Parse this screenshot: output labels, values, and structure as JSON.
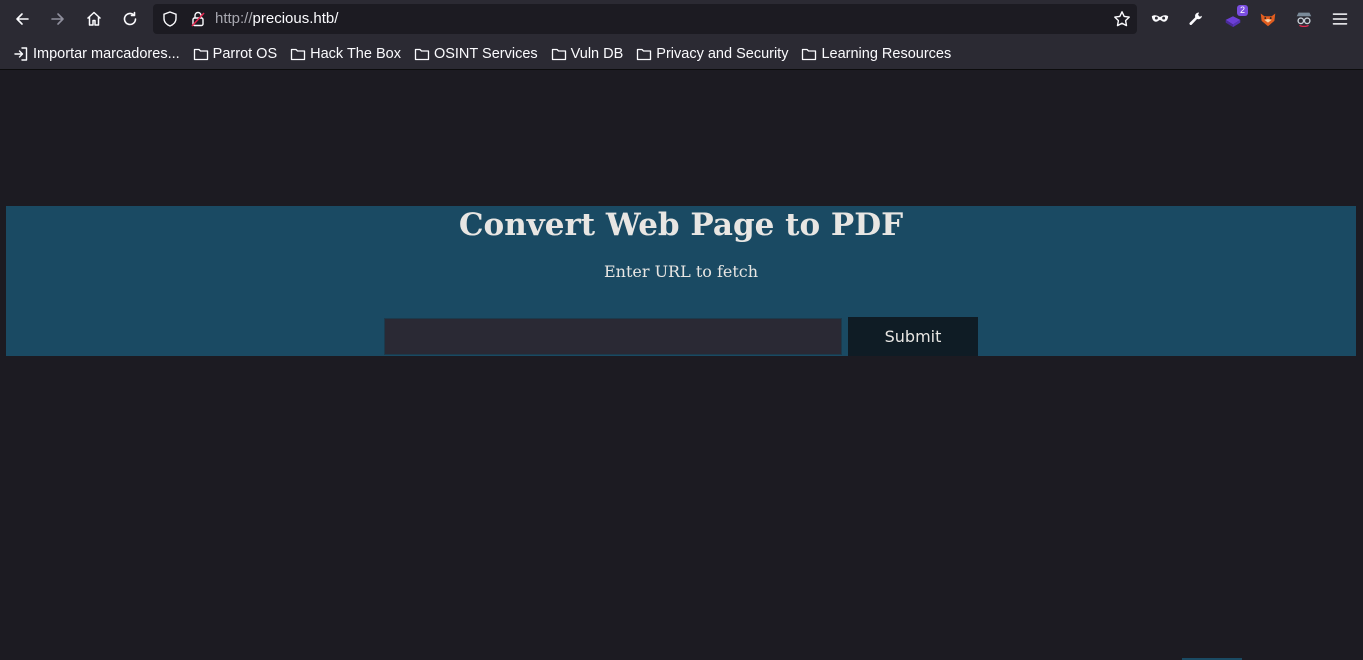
{
  "browser": {
    "url_scheme": "http://",
    "url_host": "precious.htb/",
    "extensions": [
      {
        "icon": "mask-icon"
      },
      {
        "icon": "wrench-icon"
      },
      {
        "icon": "extension-badge-icon",
        "badge": "2"
      },
      {
        "icon": "fox-extension-icon"
      },
      {
        "icon": "spy-extension-icon"
      }
    ]
  },
  "bookmarks": [
    {
      "label": "Importar marcadores...",
      "icon": "import-icon"
    },
    {
      "label": "Parrot OS",
      "icon": "folder-icon"
    },
    {
      "label": "Hack The Box",
      "icon": "folder-icon"
    },
    {
      "label": "OSINT Services",
      "icon": "folder-icon"
    },
    {
      "label": "Vuln DB",
      "icon": "folder-icon"
    },
    {
      "label": "Privacy and Security",
      "icon": "folder-icon"
    },
    {
      "label": "Learning Resources",
      "icon": "folder-icon"
    }
  ],
  "page": {
    "title": "Convert Web Page to PDF",
    "subtitle": "Enter URL to fetch",
    "input_value": "",
    "submit_label": "Submit",
    "colors": {
      "banner": "#1a4a63",
      "background": "#1c1b22",
      "button": "#0f1c25"
    }
  }
}
